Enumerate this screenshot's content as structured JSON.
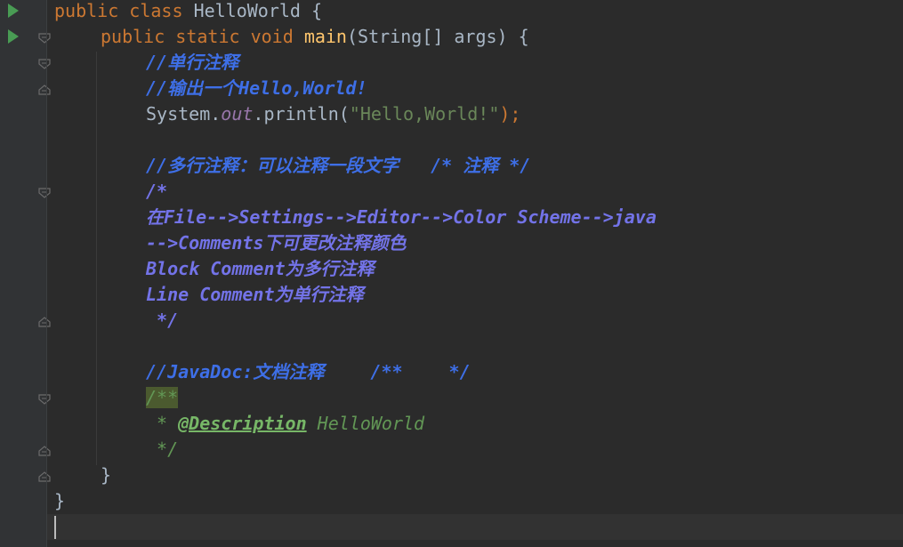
{
  "editor": {
    "colors": {
      "background": "#2b2b2b",
      "gutter": "#313335",
      "keyword": "#cc7832",
      "method": "#ffc66d",
      "string": "#6a8759",
      "field": "#9876aa",
      "line_comment": "#3e6fe7",
      "block_comment": "#7373e8",
      "doc_comment": "#629755",
      "doc_tag": "#77b767",
      "run_icon": "#499c54"
    },
    "gutter_icons": [
      "run-icon",
      "run-icon",
      "fold-icon"
    ],
    "lines": {
      "l1": {
        "kw1": "public",
        "kw2": "class",
        "name": "HelloWorld",
        "brace": "{"
      },
      "l2": {
        "kw1": "public",
        "kw2": "static",
        "kw3": "void",
        "method": "main",
        "params": "(String[] args)",
        "brace": "{"
      },
      "l3": {
        "comment": "//单行注释"
      },
      "l4": {
        "comment": "//输出一个Hello,World!"
      },
      "l5": {
        "pre": "System.",
        "field": "out",
        "call": ".println(",
        "string": "\"Hello,World!\"",
        "end": ");"
      },
      "l7": {
        "comment1": "//多行注释：可以注释一段文字",
        "comment2": "/* 注释 */"
      },
      "l8": {
        "text": "/*"
      },
      "l9": {
        "text": "在File-->Settings-->Editor-->Color Scheme-->java"
      },
      "l10": {
        "text": "-->Comments下可更改注释颜色"
      },
      "l11": {
        "text": "Block Comment为多行注释"
      },
      "l12": {
        "text": "Line Comment为单行注释"
      },
      "l13": {
        "text": " */"
      },
      "l15": {
        "comment1": "//JavaDoc:文档注释",
        "comment2": "/**",
        "comment3": "*/"
      },
      "l16": {
        "text": "/**"
      },
      "l17": {
        "star": " * ",
        "tag": "@Description",
        "desc": " HelloWorld"
      },
      "l18": {
        "text": " */"
      },
      "l19": {
        "brace": "}"
      },
      "l20": {
        "brace": "}"
      }
    }
  }
}
